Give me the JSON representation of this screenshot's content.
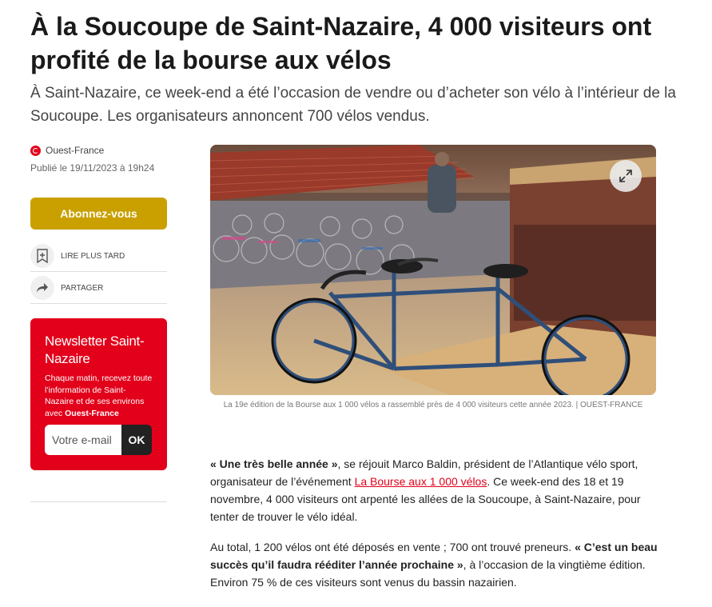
{
  "article": {
    "title": "À la Soucoupe de Saint-Nazaire, 4 000 visiteurs ont profité de la bourse aux vélos",
    "lede": "À Saint-Nazaire, ce week-end a été l’occasion de vendre ou d’acheter son vélo à l’intérieur de la Soucoupe. Les organisateurs annoncent 700 vélos vendus."
  },
  "meta": {
    "source": "Ouest-France",
    "published": "Publié le 19/11/2023 à 19h24"
  },
  "sidebar": {
    "subscribe_label": "Abonnez-vous",
    "read_later_label": "LIRE PLUS TARD",
    "share_label": "PARTAGER"
  },
  "newsletter": {
    "title": "Newsletter Saint-Nazaire",
    "text": "Chaque matin, recevez toute l’information de Saint-Nazaire et de ses environs avec ",
    "text_brand": "Ouest-France",
    "email_placeholder": "Votre e-mail",
    "ok_label": "OK"
  },
  "image": {
    "caption": "La 19e édition de la Bourse aux 1 000 vélos a rassemblé près de 4 000 visiteurs cette année 2023. | OUEST-FRANCE"
  },
  "body": {
    "p1_quote": "« Une très belle année »",
    "p1_a": ", se réjouit Marco Baldin, président de l’Atlantique vélo sport, organisateur de l’événement ",
    "p1_link": "La Bourse aux 1 000 vélos",
    "p1_b": ". Ce week-end des 18 et 19 novembre, 4 000 visiteurs ont arpenté les allées de la Soucoupe, à Saint-Nazaire, pour tenter de trouver le vélo idéal.",
    "p2_a": "Au total, 1 200 vélos ont été déposés en vente ; 700 ont trouvé preneurs. ",
    "p2_quote": "« C’est un beau succès qu’il faudra rééditer l’année prochaine »",
    "p2_b": ", à l’occasion de la vingtième édition. Environ 75 % de ces visiteurs sont venus du bassin nazairien."
  },
  "colors": {
    "brand_red": "#e2001a",
    "subscribe_gold": "#c9a000"
  },
  "icons": [
    "ouest-france-logo-icon",
    "bookmark-plus-icon",
    "share-arrow-icon",
    "expand-icon"
  ]
}
